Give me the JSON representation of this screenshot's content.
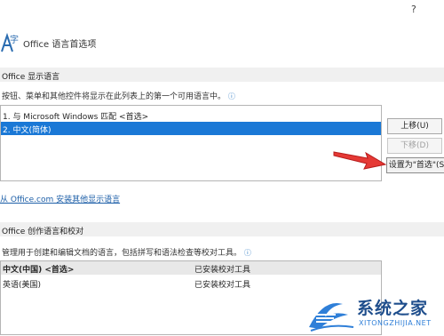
{
  "help": "?",
  "header": {
    "title": "Office 语言首选项"
  },
  "display_section": {
    "heading": "Office 显示语言",
    "description": "按钮、菜单和其他控件将显示在此列表上的第一个可用语言中。",
    "info": "ⓘ",
    "languages": [
      {
        "label": "1.   与 Microsoft Windows 匹配 <首选>"
      },
      {
        "label": "2.   中文(简体)"
      }
    ],
    "buttons": {
      "up": "上移(U)",
      "down": "下移(D)",
      "prefer": "设置为\"首选\"(S"
    },
    "link": "从 Office.com 安装其他显示语言"
  },
  "authoring_section": {
    "heading": "Office 创作语言和校对",
    "description": "管理用于创建和编辑文档的语言，包括拼写和语法检查等校对工具。",
    "info": "ⓘ",
    "columns": [
      "中文(中国) <首选>",
      "已安装校对工具"
    ],
    "rows": [
      {
        "lang": "英语(美国)",
        "status": "已安装校对工具"
      }
    ]
  },
  "watermark": {
    "name": "系统之家",
    "url": "XITONGZHIJIA.NET"
  },
  "colors": {
    "selection": "#1a78d6",
    "accent_red": "#e53935",
    "link": "#1d5fa8"
  }
}
